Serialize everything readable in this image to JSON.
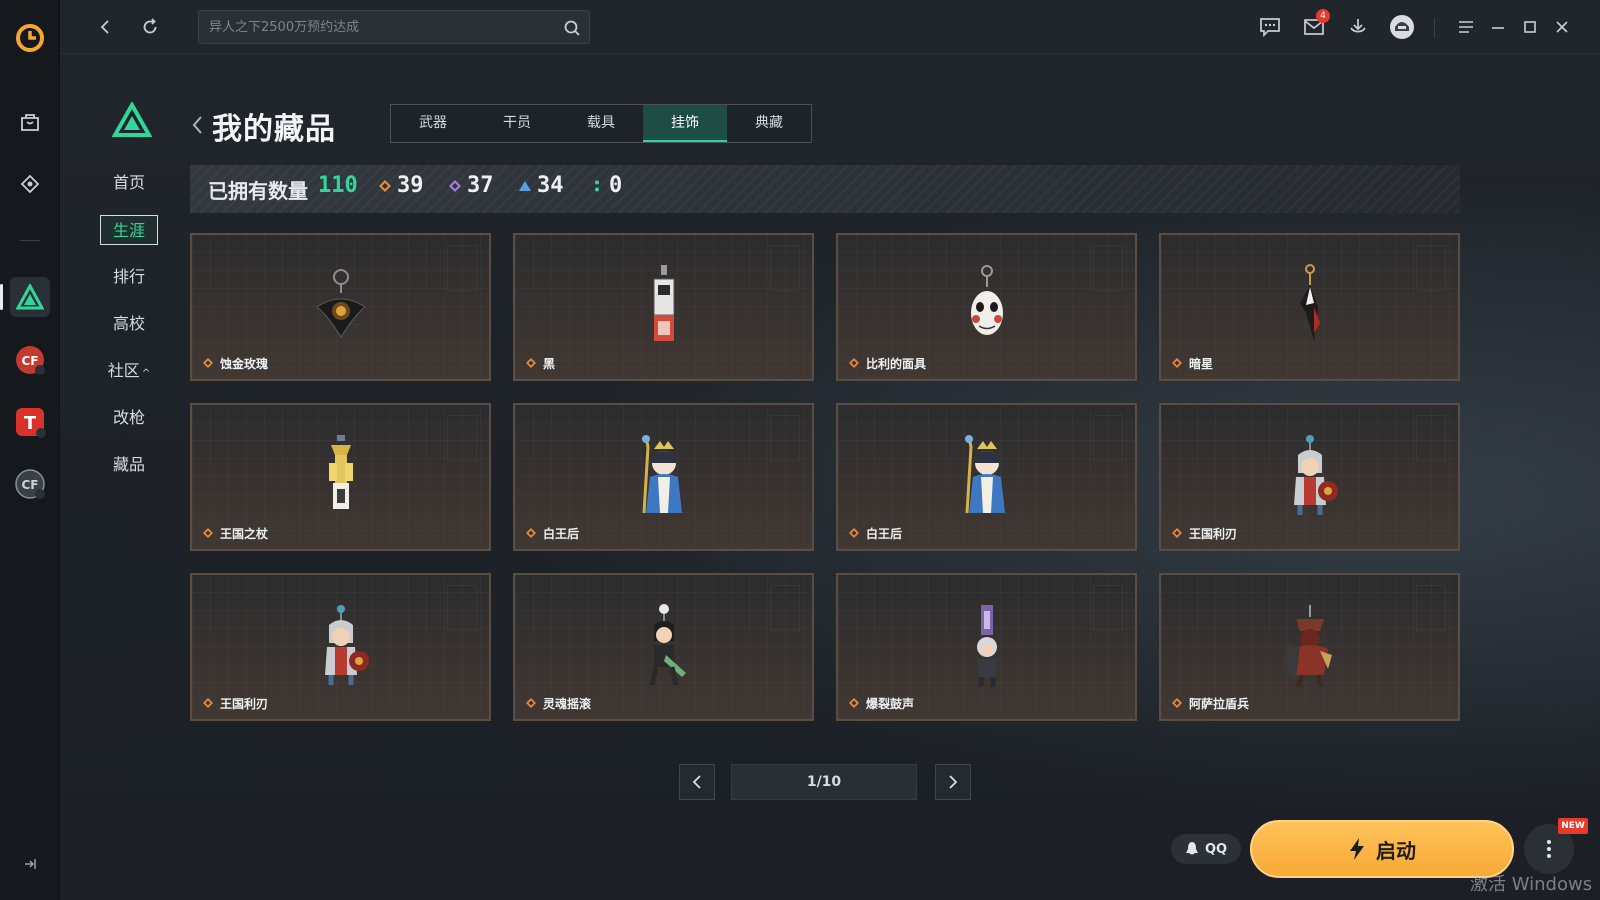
{
  "app": {
    "search_placeholder": "异人之下2500万预约达成",
    "mail_badge": "4"
  },
  "game_nav": {
    "items": [
      {
        "label": "首页"
      },
      {
        "label": "生涯",
        "active": true
      },
      {
        "label": "排行"
      },
      {
        "label": "高校"
      },
      {
        "label": "社区"
      },
      {
        "label": "改枪"
      },
      {
        "label": "藏品"
      }
    ]
  },
  "page": {
    "title": "我的藏品",
    "tabs": [
      {
        "label": "武器"
      },
      {
        "label": "干员"
      },
      {
        "label": "载具"
      },
      {
        "label": "挂饰",
        "active": true
      },
      {
        "label": "典藏"
      }
    ]
  },
  "stats": {
    "label": "已拥有数量",
    "total": "110",
    "orange": "39",
    "purple": "37",
    "blue": "34",
    "green": "0"
  },
  "rarity_colors": {
    "orange": "#e48a3c",
    "purple": "#a57be0",
    "blue": "#5b9ee6",
    "green": "#31d79a"
  },
  "collection": {
    "items": [
      {
        "name": "蚀金玫瑰",
        "icon": "rose-charm"
      },
      {
        "name": "黑",
        "icon": "tag-charm"
      },
      {
        "name": "比利的面具",
        "icon": "mask-charm"
      },
      {
        "name": "暗星",
        "icon": "dark-star-charm"
      },
      {
        "name": "王国之杖",
        "icon": "scepter-charm"
      },
      {
        "name": "白王后",
        "icon": "white-queen-charm"
      },
      {
        "name": "白王后",
        "icon": "white-queen-charm"
      },
      {
        "name": "王国利刃",
        "icon": "knight-charm"
      },
      {
        "name": "王国利刃",
        "icon": "knight-charm"
      },
      {
        "name": "灵魂摇滚",
        "icon": "rocker-charm"
      },
      {
        "name": "爆裂鼓声",
        "icon": "drummer-charm"
      },
      {
        "name": "阿萨拉盾兵",
        "icon": "shield-soldier-charm"
      }
    ]
  },
  "pagination": {
    "label": "1/10"
  },
  "footer": {
    "qq_label": "QQ",
    "launch_label": "启动",
    "new_badge": "NEW",
    "watermark": "激活 Windows"
  }
}
